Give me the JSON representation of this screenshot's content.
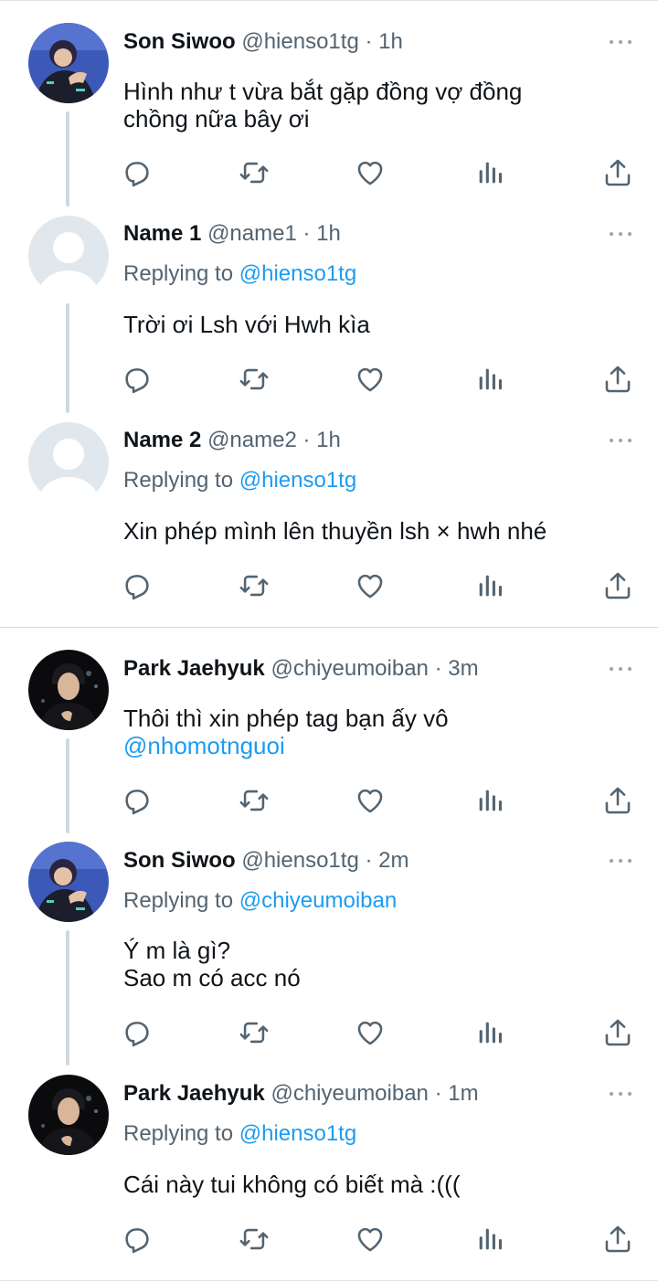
{
  "meta_separator": " · ",
  "replying_prefix": "Replying to ",
  "icons": {
    "reply": "reply-icon",
    "retweet": "retweet-icon",
    "like": "like-icon",
    "views": "views-icon",
    "share": "share-icon",
    "more": "more-icon"
  },
  "colors": {
    "link": "#1d9bf0",
    "muted": "#536471",
    "thread_line": "#cfd9de"
  },
  "threads": [
    {
      "tweets": [
        {
          "name": "Son Siwoo",
          "handle": "@hienso1tg",
          "time": "1h",
          "reply_to": "",
          "text_lines": [
            "Hình như t vừa bắt gặp đồng vợ đồng",
            "chồng nữa bây ơi"
          ]
        },
        {
          "name": "Name 1",
          "handle": "@name1",
          "time": "1h",
          "reply_to": "@hienso1tg",
          "text_lines": [
            "Trời ơi Lsh với Hwh kìa"
          ]
        },
        {
          "name": "Name 2",
          "handle": "@name2",
          "time": "1h",
          "reply_to": "@hienso1tg",
          "text_lines": [
            "Xin phép mình lên thuyền lsh × hwh nhé"
          ]
        }
      ]
    },
    {
      "tweets": [
        {
          "name": "Park Jaehyuk",
          "handle": "@chiyeumoiban",
          "time": "3m",
          "reply_to": "",
          "text_lines": [
            "Thôi thì xin phép tag bạn ấy vô"
          ],
          "mention": "@nhomotnguoi"
        },
        {
          "name": "Son Siwoo",
          "handle": "@hienso1tg",
          "time": "2m",
          "reply_to": "@chiyeumoiban",
          "text_lines": [
            "Ý m là gì?",
            "Sao m có acc nó"
          ]
        },
        {
          "name": "Park Jaehyuk",
          "handle": "@chiyeumoiban",
          "time": "1m",
          "reply_to": "@hienso1tg",
          "text_lines": [
            "Cái này tui không có biết mà :((("
          ]
        }
      ]
    }
  ]
}
